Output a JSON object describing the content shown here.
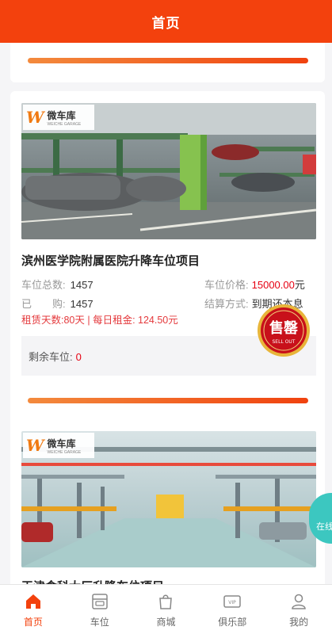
{
  "header": {
    "title": "首页"
  },
  "projects": [
    {
      "logo": {
        "mark": "W",
        "name": "微车库",
        "sub": "WEICHE GARAGE"
      },
      "title": "滨州医学院附属医院升降车位项目",
      "total_label": "车位总数:",
      "total_value": "1457",
      "price_label": "车位价格:",
      "price_value": "15000.00",
      "price_unit": "元",
      "sold_label": "已　　购:",
      "sold_value": "1457",
      "settle_label": "结算方式:",
      "settle_value": "到期还本息",
      "rent_text": "租赁天数:80天 | 每日租金: 124.50元",
      "remain_label": "剩余车位:",
      "remain_value": "0",
      "progress": 1.0,
      "badge": {
        "zh": "售罄",
        "en": "SELL OUT"
      }
    },
    {
      "logo": {
        "mark": "W",
        "name": "微车库",
        "sub": "WEICHE GARAGE"
      },
      "title": "天津食科大厂升降车位项目"
    }
  ],
  "side_float": {
    "label": "在线"
  },
  "tabbar": [
    {
      "label": "首页",
      "icon": "home-icon",
      "active": true
    },
    {
      "label": "车位",
      "icon": "parking-icon",
      "active": false
    },
    {
      "label": "商城",
      "icon": "shopping-bag-icon",
      "active": false
    },
    {
      "label": "俱乐部",
      "icon": "vip-card-icon",
      "active": false
    },
    {
      "label": "我的",
      "icon": "user-icon",
      "active": false
    }
  ],
  "colors": {
    "brand": "#f3410d",
    "price_red": "#e60012",
    "progress_start": "#f38a3d",
    "progress_end": "#f0420f"
  }
}
